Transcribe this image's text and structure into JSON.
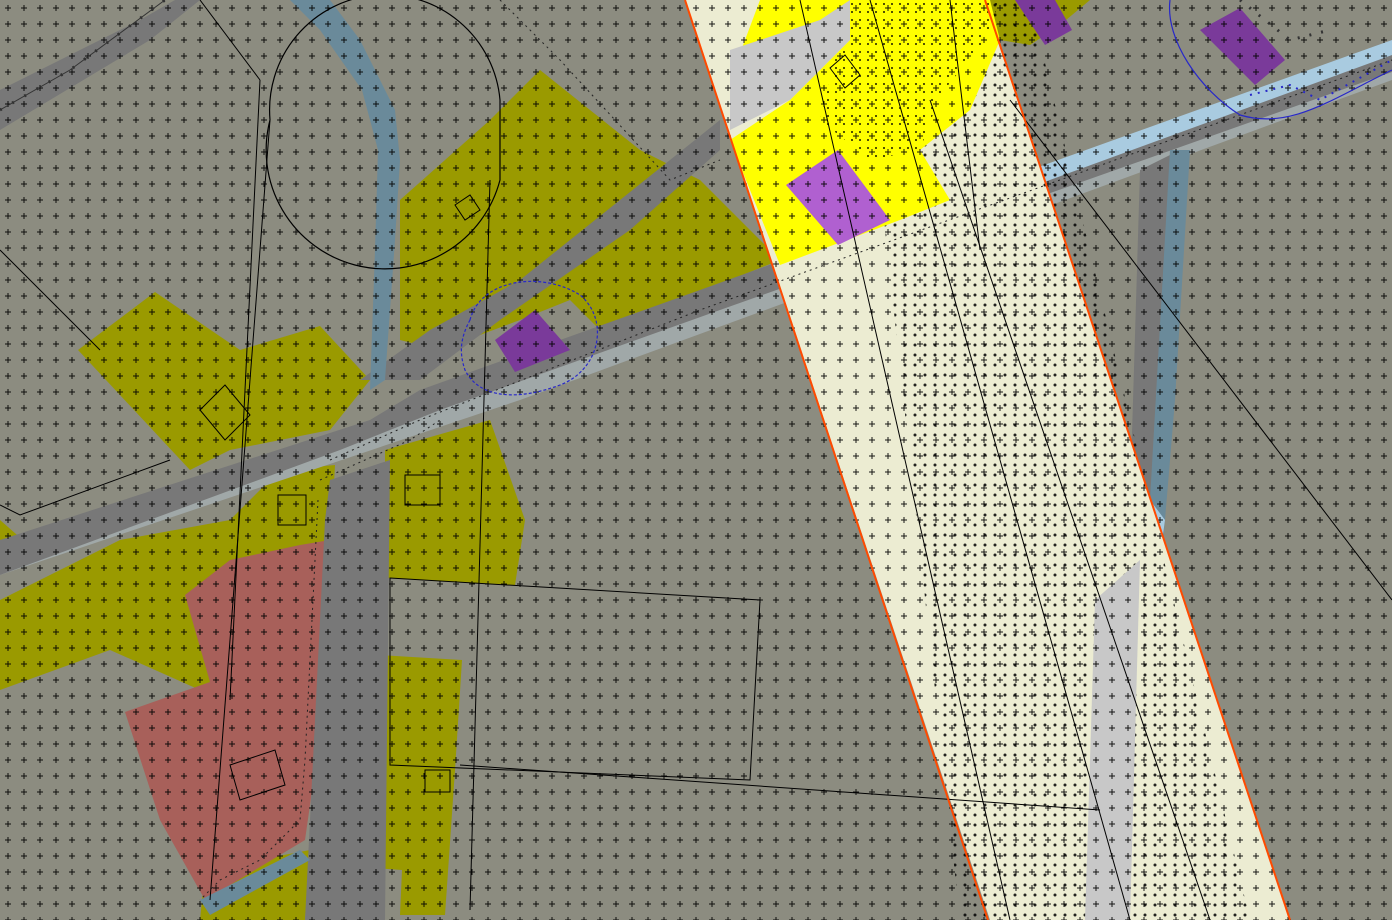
{
  "map": {
    "view": "cadastral-zoning-plan",
    "labels": [],
    "colors": {
      "background": "#8c8c80",
      "agricultural_zone": "#9a9a00",
      "residential_yellow": "#ffff00",
      "residential_light": "#ececd2",
      "road_grey": "#787878",
      "road_light": "#c8c8c8",
      "water_channel": "#6a8a9a",
      "water_light": "#a9cbe0",
      "building_purple": "#7a3a9a",
      "building_violet": "#b060d0",
      "special_zone_red": "#a8605a",
      "highway_boundary": "#ff4a00",
      "survey_line": "#000000",
      "protection_buffer": "#2828c8"
    },
    "icons": [
      "plus-grid-pattern",
      "dot-pattern"
    ]
  }
}
